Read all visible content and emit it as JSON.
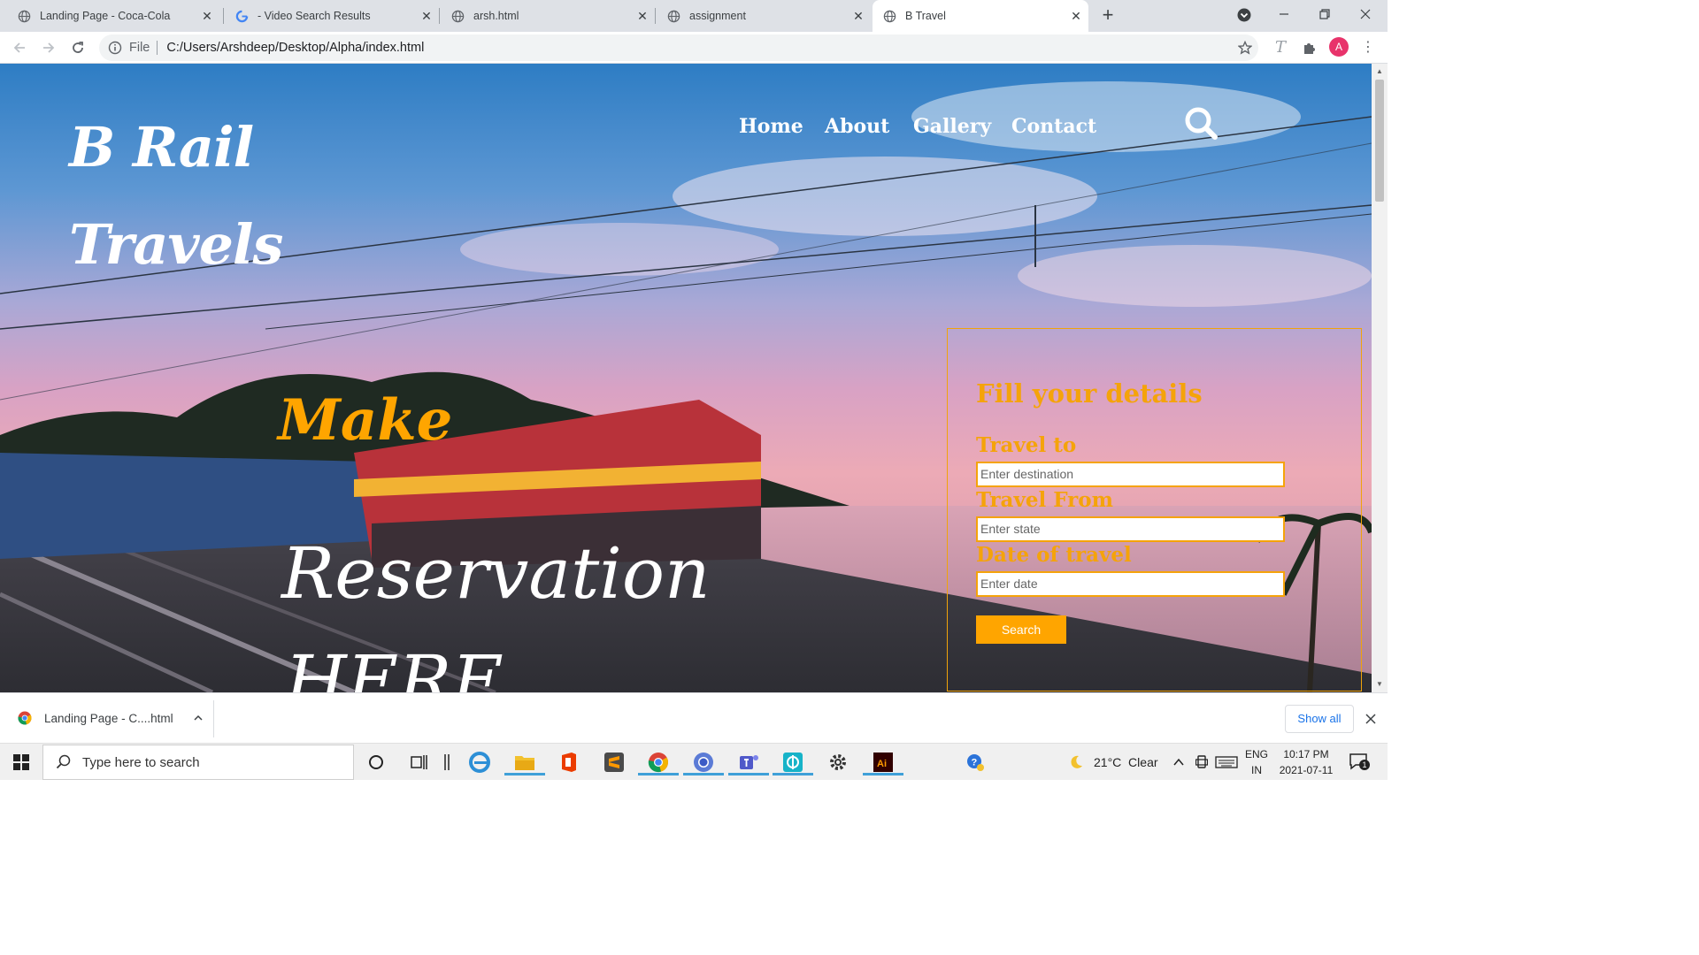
{
  "browser": {
    "tabs": [
      {
        "title": "Landing Page - Coca-Cola",
        "favicon": "globe-icon",
        "active": false
      },
      {
        "title": "- Video Search Results",
        "favicon": "google-icon",
        "active": false
      },
      {
        "title": "arsh.html",
        "favicon": "globe-icon",
        "active": false
      },
      {
        "title": "assignment",
        "favicon": "globe-icon",
        "active": false
      },
      {
        "title": "B Travel",
        "favicon": "globe-icon",
        "active": true
      }
    ],
    "address": {
      "scheme_label": "File",
      "url": "C:/Users/Arshdeep/Desktop/Alpha/index.html"
    },
    "profile_initial": "A"
  },
  "page": {
    "logo_line1": "B Rail",
    "logo_line2": "Travels",
    "nav": [
      "Home",
      "About",
      "Gallery",
      "Contact"
    ],
    "hero": {
      "line1": "Make",
      "line2": "Reservation",
      "line3": "HERE"
    },
    "form": {
      "title": "Fill your details",
      "fields": [
        {
          "label": "Travel to",
          "placeholder": "Enter destination"
        },
        {
          "label": "Travel From",
          "placeholder": "Enter state"
        },
        {
          "label": "Date of travel",
          "placeholder": "Enter date"
        }
      ],
      "button": "Search"
    },
    "colors": {
      "accent": "#f5a30a",
      "button": "#ffa500",
      "nav_text": "#ffffff"
    }
  },
  "downloads": {
    "item": "Landing Page - C....html",
    "show_all": "Show all"
  },
  "taskbar": {
    "search_placeholder": "Type here to search",
    "weather": "21°C  Clear",
    "lang_top": "ENG",
    "lang_bottom": "IN",
    "time": "10:17 PM",
    "date": "2021-07-11",
    "notification_count": "1"
  }
}
